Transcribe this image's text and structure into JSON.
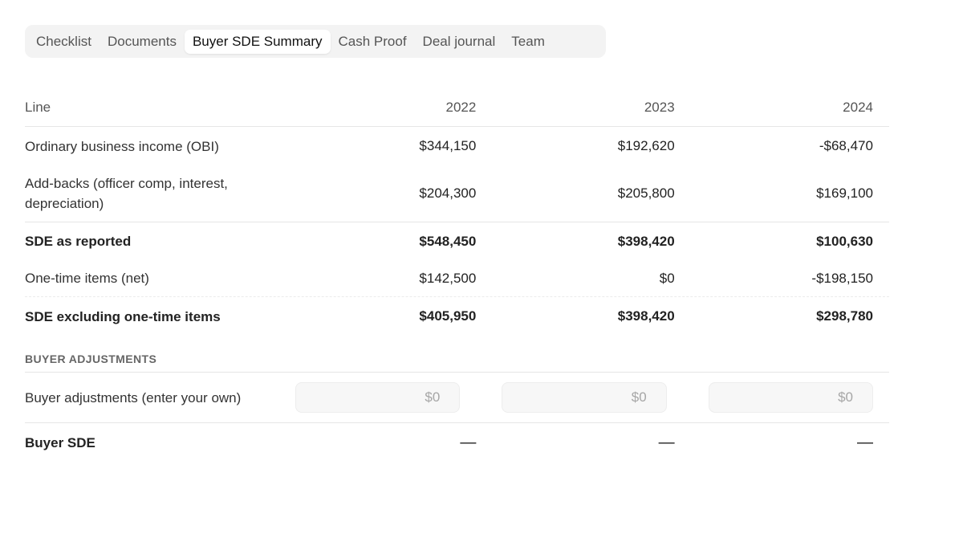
{
  "tabs": [
    {
      "label": "Checklist"
    },
    {
      "label": "Documents"
    },
    {
      "label": "Buyer SDE Summary",
      "active": true
    },
    {
      "label": "Cash Proof"
    },
    {
      "label": "Deal journal"
    },
    {
      "label": "Team"
    }
  ],
  "table": {
    "header": {
      "line": "Line",
      "years": [
        "2022",
        "2023",
        "2024"
      ]
    },
    "rows": [
      {
        "label": "Ordinary business income (OBI)",
        "values": [
          "$344,150",
          "$192,620",
          "-$68,470"
        ]
      },
      {
        "label": "Add-backs (officer comp, interest, depreciation)",
        "values": [
          "$204,300",
          "$205,800",
          "$169,100"
        ]
      },
      {
        "label": "SDE as reported",
        "values": [
          "$548,450",
          "$398,420",
          "$100,630"
        ]
      },
      {
        "label": "One-time items (net)",
        "values": [
          "$142,500",
          "$0",
          "-$198,150"
        ]
      },
      {
        "label": "SDE excluding one-time items",
        "values": [
          "$405,950",
          "$398,420",
          "$298,780"
        ]
      }
    ],
    "section_title": "BUYER ADJUSTMENTS",
    "adjustments": {
      "label": "Buyer adjustments (enter your own)",
      "placeholders": [
        "$0",
        "$0",
        "$0"
      ]
    },
    "buyer_sde": {
      "label": "Buyer SDE",
      "values": [
        "—",
        "—",
        "—"
      ]
    }
  }
}
